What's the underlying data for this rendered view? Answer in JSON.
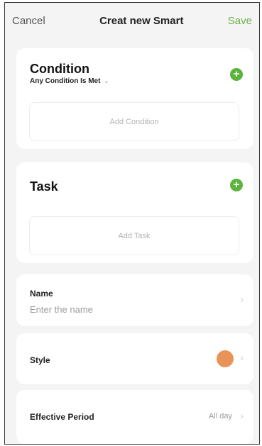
{
  "nav": {
    "cancel_label": "Cancel",
    "title": "Creat new Smart",
    "save_label": "Save"
  },
  "condition": {
    "title": "Condition",
    "mode": "Any Condition Is Met",
    "mode_caret": "⌄",
    "add_icon": "plus-icon",
    "placeholder": "Add Condition"
  },
  "task": {
    "title": "Task",
    "add_icon": "plus-icon",
    "placeholder": "Add Task"
  },
  "name": {
    "label": "Name",
    "placeholder": "Enter the name"
  },
  "style": {
    "label": "Style",
    "color": "#e8935a"
  },
  "period": {
    "label": "Effective Period",
    "value": "All day"
  },
  "colors": {
    "accent_green": "#5cb43f",
    "save_green": "#69b24a",
    "background": "#f4f4f4"
  }
}
